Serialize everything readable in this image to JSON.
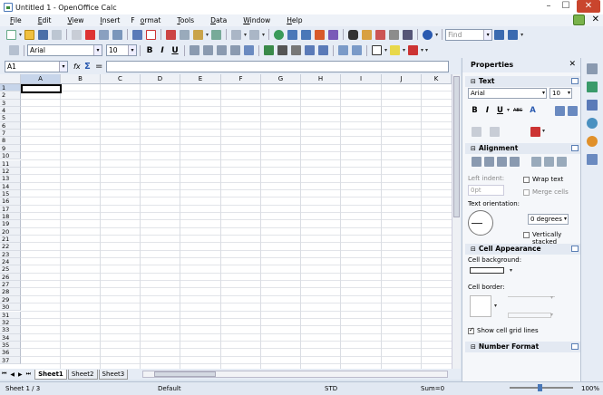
{
  "window": {
    "title": "Untitled 1 - OpenOffice Calc"
  },
  "menu": [
    {
      "pre": "",
      "u": "F",
      "post": "ile"
    },
    {
      "pre": "",
      "u": "E",
      "post": "dit"
    },
    {
      "pre": "",
      "u": "V",
      "post": "iew"
    },
    {
      "pre": "",
      "u": "I",
      "post": "nsert"
    },
    {
      "pre": "F",
      "u": "o",
      "post": "rmat"
    },
    {
      "pre": "",
      "u": "T",
      "post": "ools"
    },
    {
      "pre": "",
      "u": "D",
      "post": "ata"
    },
    {
      "pre": "",
      "u": "W",
      "post": "indow"
    },
    {
      "pre": "",
      "u": "H",
      "post": "elp"
    }
  ],
  "toolbar": {
    "find_placeholder": "Find"
  },
  "format": {
    "font_name": "Arial",
    "font_size": "10",
    "bold": "B",
    "italic": "I",
    "underline": "U"
  },
  "formula_bar": {
    "cell_ref": "A1",
    "fx": "fx",
    "sum": "Σ",
    "equals": "=",
    "formula": ""
  },
  "grid": {
    "columns": [
      "A",
      "B",
      "C",
      "D",
      "E",
      "F",
      "G",
      "H",
      "I",
      "J",
      "K"
    ],
    "rows": [
      "1",
      "2",
      "3",
      "4",
      "5",
      "6",
      "7",
      "8",
      "9",
      "10",
      "11",
      "12",
      "13",
      "14",
      "15",
      "16",
      "17",
      "18",
      "19",
      "20",
      "21",
      "22",
      "23",
      "24",
      "25",
      "26",
      "27",
      "28",
      "29",
      "30",
      "31",
      "32",
      "33",
      "34",
      "35",
      "36",
      "37"
    ],
    "active_cell": "A1"
  },
  "sheet_tabs": [
    "Sheet1",
    "Sheet2",
    "Sheet3"
  ],
  "status": {
    "sheet": "Sheet 1 / 3",
    "style": "Default",
    "mode": "STD",
    "sum": "Sum=0",
    "zoom": "100%"
  },
  "panel": {
    "title": "Properties",
    "text_section": "Text",
    "font_name": "Arial",
    "font_size": "10",
    "bold": "B",
    "italic": "I",
    "underline": "U",
    "strike": "ABC",
    "shadow": "A",
    "alignment_section": "Alignment",
    "left_indent_label": "Left indent:",
    "left_indent_value": "0pt",
    "wrap_text": "Wrap text",
    "merge_cells": "Merge cells",
    "text_orientation_label": "Text orientation:",
    "orientation_value": "0 degrees",
    "vertically_stacked": "Vertically stacked",
    "cell_appearance_section": "Cell Appearance",
    "cell_background_label": "Cell background:",
    "cell_border_label": "Cell border:",
    "show_grid_lines": "Show cell grid lines",
    "number_format_section": "Number Format"
  },
  "colors": {
    "accent": "#4a78b8",
    "header_bg": "#eef1f6",
    "panel_bg": "#f5f7fa"
  }
}
